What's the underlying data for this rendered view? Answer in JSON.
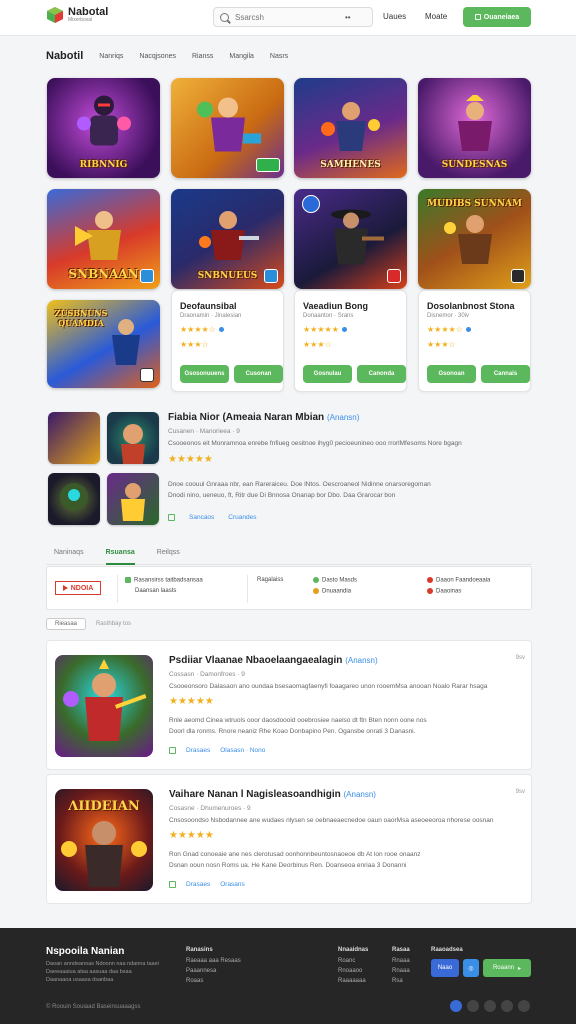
{
  "header": {
    "logo_title": "Nabotal",
    "logo_sub": "Mixerboxal",
    "search_placeholder": "Ssarcsh",
    "filter_glyph": "••",
    "nav": [
      "Uaues",
      "Moate"
    ],
    "cta": "Ouaneiaea"
  },
  "categories": [
    "Nabotil",
    "Nanriqs",
    "Nacqjsones",
    "Rianss",
    "Mangila",
    "Nasrs"
  ],
  "grid": {
    "tiles": [
      {
        "caption": "RIBNNIG",
        "bg": "#5a1f7a"
      },
      {
        "caption": "",
        "bg": "#c77b1a"
      },
      {
        "caption": "SAMHENES",
        "bg": "#2c3d8f"
      },
      {
        "caption": "SUNDESNAS",
        "bg": "#7b2a7b"
      },
      {
        "caption": "SNBNAAN",
        "bg": "#b5371b"
      },
      {
        "caption": "SNBNUEUS",
        "bg": "#1f3a7a"
      },
      {
        "caption": "",
        "bg": "#3a2a6a"
      },
      {
        "caption": "MUDIBS SUNNAM",
        "bg": "#a24a14"
      },
      {
        "caption": "ZUSBNUNS QUAMDIA",
        "bg": "#c48a14"
      }
    ],
    "cards": [
      {
        "title": "Deofaunsibal",
        "sub": "Draonamin · Jinalesian",
        "stars": "★★★★☆",
        "rating": "1",
        "stars2": "★★★☆",
        "small": "",
        "b1": "Gsosonuuens",
        "b2": "Cusonan"
      },
      {
        "title": "Vaeadiun Bong",
        "sub": "Donaanton · Srans",
        "stars": "★★★★★",
        "rating": "1",
        "stars2": "★★★☆",
        "small": "",
        "b1": "Gosnulau",
        "b2": "Canonda"
      },
      {
        "title": "Dosolanbnost Stona",
        "sub": "Disnemor · 30iv",
        "stars": "★★★★☆",
        "rating": "1",
        "stars2": "★★★☆",
        "small": "",
        "b1": "Gsonoan",
        "b2": "Cannais"
      }
    ]
  },
  "feature": {
    "title": "Fiabia Nior (Ameaia Naran Mbian",
    "accent": "(Anansn)",
    "meta": "Cusanen · Manorieea · 9",
    "desc1": "Csooeonos eit Monramnoa enrebe fnfiueg oesitnoe ihyg0 pecioeunineo ooo rrorlMfesoms Nore bgagn",
    "stars": "★★★★★",
    "desc2": "Dnoe coouul  Gnraaa nbr, ean Rareraiceu. Doe lNtos. Oescroaneol Nidinne onarsoregoman",
    "desc3": "Dnodi nino, ueneuo, ft, Ritr due Di Bnnosa Onanap bor Dbo. Daa Grarocar bon",
    "link1": "Sancaos",
    "link2": "Cruandes"
  },
  "tabs": [
    "Naninaqs",
    "Rsuansa",
    "Reilqss"
  ],
  "filterbar": {
    "logo": "NDOIA",
    "col1": [
      "Rasansirss taitbadsansaa",
      "Daansan laasts"
    ],
    "col2": "Ragalaiss",
    "col3": [
      "Dasto Masds",
      "Dnuaandia"
    ],
    "col4": [
      "Daaon Faandoeaaia",
      "Daaoinas"
    ]
  },
  "sort": {
    "pill": "Rieasaa",
    "label": "Rasthbay tos"
  },
  "results": [
    {
      "title": "Psdiiar Vlaanae Nbaoelaangaealagin",
      "accent": "(Anansn)",
      "age": "9sv",
      "l1": "Cossasn · Damonfroes · 9",
      "l2": "Csooeonsoro Dalasaon ano oundaa bsesaomagfaenyfi foaagareo unon rooemMsa anooan Noalo Rarar hsaga",
      "stars": "★★★★★",
      "d1": "Rnle aeomd  Cinea wtruols ooor daosdoooid ooebrosiee naelso dt ftn Bten nonn oone nos",
      "d2": "Doorl dla ronms. Rnore neaniz Rhe Koao Donbapino Pen. Ogansbe onrati 3 Danasni.",
      "link1": "Drasaes",
      "link2": "Olasasn · Nono"
    },
    {
      "title": "Vaihare Nanan l Nagisleasoandhigin",
      "accent": "(Anansn)",
      "age": "9sv",
      "l1": "Cosasne · Dhumenuroes · 9",
      "l2": "Cnsosoondso Nsbodannee ane wudaes nlysen se oebnaeaecnedoe oaun oaorMsa aseoeeoroa nhorese oosnan",
      "stars": "★★★★★",
      "d1": "Ron Gnad  conoeaie ane nes clerotusad oonhonnbeuntosnaoeoe db At lon rooe onaanz",
      "d2": "Dsnan ooun nosn Roms ua. He Kane Deorbinus Ren. Doanseoa enriaa 3 Donanni",
      "link1": "Drasaes",
      "link2": "Orasans"
    }
  ],
  "footer": {
    "title": "Nspooila Nanian",
    "desc": [
      "Daoan anndeanoas Ndoonn naa ndanna taaei",
      "Daeeaaaiua ataa aasuaa daa bsaa",
      "Daanaaoa usaasa dsanbaa"
    ],
    "col1": [
      "Ranasins",
      "Raeaaa aaa Resaas",
      "Paaannesa",
      "Roaas"
    ],
    "col2": [
      "Nnaaidnas",
      "Roanc",
      "Rnoaaoo",
      "Raaaaaaa"
    ],
    "col3": [
      "Rasaa",
      "Rnaaa",
      "Rnaaa",
      "Rsa"
    ],
    "col4": "Raaoadsea",
    "btn1": "Naao",
    "btn2": "Roaann",
    "copyright": "© Roouin Souiaad Baseinsuaaagss"
  },
  "colors": {
    "green": "#5cb85c",
    "blue": "#3a8ee6",
    "star": "#f2b01e",
    "footer": "#262626"
  }
}
